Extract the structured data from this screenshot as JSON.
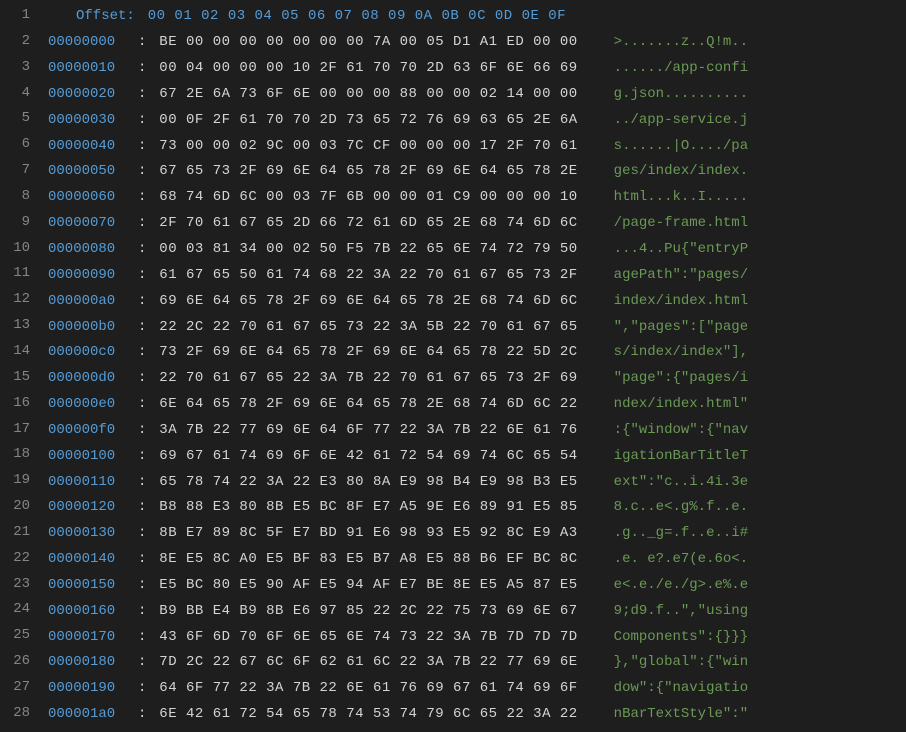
{
  "header": {
    "label": "Offset",
    "columns": "00 01 02 03 04 05 06 07 08 09 0A 0B 0C 0D 0E 0F"
  },
  "rows": [
    {
      "offset": "00000000",
      "bytes": "BE 00 00 00 00 00 00 00 7A 00 05 D1 A1 ED 00 00",
      "ascii": ">.......z..Q!m.."
    },
    {
      "offset": "00000010",
      "bytes": "00 04 00 00 00 10 2F 61 70 70 2D 63 6F 6E 66 69",
      "ascii": "....../app-confi"
    },
    {
      "offset": "00000020",
      "bytes": "67 2E 6A 73 6F 6E 00 00 00 88 00 00 02 14 00 00",
      "ascii": "g.json.........."
    },
    {
      "offset": "00000030",
      "bytes": "00 0F 2F 61 70 70 2D 73 65 72 76 69 63 65 2E 6A",
      "ascii": "../app-service.j"
    },
    {
      "offset": "00000040",
      "bytes": "73 00 00 02 9C 00 03 7C CF 00 00 00 17 2F 70 61",
      "ascii": "s......|O..../pa"
    },
    {
      "offset": "00000050",
      "bytes": "67 65 73 2F 69 6E 64 65 78 2F 69 6E 64 65 78 2E",
      "ascii": "ges/index/index."
    },
    {
      "offset": "00000060",
      "bytes": "68 74 6D 6C 00 03 7F 6B 00 00 01 C9 00 00 00 10",
      "ascii": "html...k..I....."
    },
    {
      "offset": "00000070",
      "bytes": "2F 70 61 67 65 2D 66 72 61 6D 65 2E 68 74 6D 6C",
      "ascii": "/page-frame.html"
    },
    {
      "offset": "00000080",
      "bytes": "00 03 81 34 00 02 50 F5 7B 22 65 6E 74 72 79 50",
      "ascii": "...4..Pu{\"entryP"
    },
    {
      "offset": "00000090",
      "bytes": "61 67 65 50 61 74 68 22 3A 22 70 61 67 65 73 2F",
      "ascii": "agePath\":\"pages/"
    },
    {
      "offset": "000000a0",
      "bytes": "69 6E 64 65 78 2F 69 6E 64 65 78 2E 68 74 6D 6C",
      "ascii": "index/index.html"
    },
    {
      "offset": "000000b0",
      "bytes": "22 2C 22 70 61 67 65 73 22 3A 5B 22 70 61 67 65",
      "ascii": "\",\"pages\":[\"page"
    },
    {
      "offset": "000000c0",
      "bytes": "73 2F 69 6E 64 65 78 2F 69 6E 64 65 78 22 5D 2C",
      "ascii": "s/index/index\"],"
    },
    {
      "offset": "000000d0",
      "bytes": "22 70 61 67 65 22 3A 7B 22 70 61 67 65 73 2F 69",
      "ascii": "\"page\":{\"pages/i"
    },
    {
      "offset": "000000e0",
      "bytes": "6E 64 65 78 2F 69 6E 64 65 78 2E 68 74 6D 6C 22",
      "ascii": "ndex/index.html\""
    },
    {
      "offset": "000000f0",
      "bytes": "3A 7B 22 77 69 6E 64 6F 77 22 3A 7B 22 6E 61 76",
      "ascii": ":{\"window\":{\"nav"
    },
    {
      "offset": "00000100",
      "bytes": "69 67 61 74 69 6F 6E 42 61 72 54 69 74 6C 65 54",
      "ascii": "igationBarTitleT"
    },
    {
      "offset": "00000110",
      "bytes": "65 78 74 22 3A 22 E3 80 8A E9 98 B4 E9 98 B3 E5",
      "ascii": "ext\":\"c..i.4i.3e"
    },
    {
      "offset": "00000120",
      "bytes": "B8 88 E3 80 8B E5 BC 8F E7 A5 9E E6 89 91 E5 85",
      "ascii": "8.c..e<.g%.f..e."
    },
    {
      "offset": "00000130",
      "bytes": "8B E7 89 8C 5F E7 BD 91 E6 98 93 E5 92 8C E9 A3",
      "ascii": ".g.._g=.f..e..i#"
    },
    {
      "offset": "00000140",
      "bytes": "8E E5 8C A0 E5 BF 83 E5 B7 A8 E5 88 B6 EF BC 8C",
      "ascii": ".e. e?.e7(e.6o<."
    },
    {
      "offset": "00000150",
      "bytes": "E5 BC 80 E5 90 AF E5 94 AF E7 BE 8E E5 A5 87 E5",
      "ascii": "e<.e./e./g>.e%.e"
    },
    {
      "offset": "00000160",
      "bytes": "B9 BB E4 B9 8B E6 97 85 22 2C 22 75 73 69 6E 67",
      "ascii": "9;d9.f..\",\"using"
    },
    {
      "offset": "00000170",
      "bytes": "43 6F 6D 70 6F 6E 65 6E 74 73 22 3A 7B 7D 7D 7D",
      "ascii": "Components\":{}}}"
    },
    {
      "offset": "00000180",
      "bytes": "7D 2C 22 67 6C 6F 62 61 6C 22 3A 7B 22 77 69 6E",
      "ascii": "},\"global\":{\"win"
    },
    {
      "offset": "00000190",
      "bytes": "64 6F 77 22 3A 7B 22 6E 61 76 69 67 61 74 69 6F",
      "ascii": "dow\":{\"navigatio"
    },
    {
      "offset": "000001a0",
      "bytes": "6E 42 61 72 54 65 78 74 53 74 79 6C 65 22 3A 22",
      "ascii": "nBarTextStyle\":\""
    }
  ]
}
